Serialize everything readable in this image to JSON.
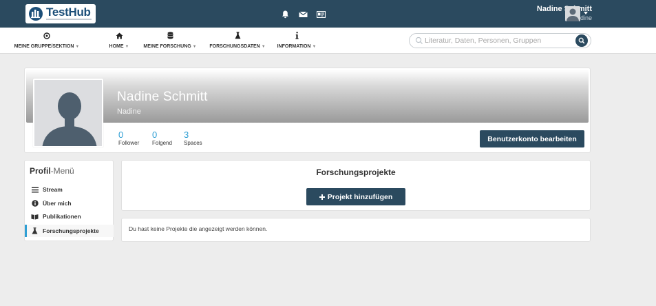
{
  "brand": {
    "name": "TestHub",
    "color_primary": "#2b4a5f",
    "color_accent": "#2f9fd4"
  },
  "topbar": {
    "icons": [
      "bell-icon",
      "mail-icon",
      "id-card-icon"
    ],
    "user": {
      "name": "Nadine Schmitt",
      "handle": "Nadine"
    }
  },
  "nav": {
    "items": [
      {
        "label": "MEINE GRUPPE/SEKTION",
        "icon": "target-icon"
      },
      {
        "label": "HOME",
        "icon": "home-icon"
      },
      {
        "label": "MEINE FORSCHUNG",
        "icon": "database-icon"
      },
      {
        "label": "FORSCHUNGSDATEN",
        "icon": "flask-icon"
      },
      {
        "label": "INFORMATION",
        "icon": "info-icon"
      }
    ],
    "caret": "▼"
  },
  "search": {
    "placeholder": "Literatur, Daten, Personen, Gruppen"
  },
  "profile": {
    "name": "Nadine Schmitt",
    "handle": "Nadine",
    "stats": [
      {
        "value": "0",
        "label": "Follower"
      },
      {
        "value": "0",
        "label": "Folgend"
      },
      {
        "value": "3",
        "label": "Spaces"
      }
    ],
    "edit_label": "Benutzerkonto bearbeiten"
  },
  "menu": {
    "title_bold": "Profil",
    "title_rest": "-Menü",
    "items": [
      {
        "label": "Stream",
        "icon": "list-icon",
        "active": false
      },
      {
        "label": "Über mich",
        "icon": "info-circle-icon",
        "active": false
      },
      {
        "label": "Publikationen",
        "icon": "book-icon",
        "active": false
      },
      {
        "label": "Forschungsprojekte",
        "icon": "flask-icon",
        "active": true
      }
    ]
  },
  "projects": {
    "title": "Forschungsprojekte",
    "add_label": "Projekt hinzufügen",
    "empty_text": "Du hast keine Projekte die angezeigt werden können."
  }
}
